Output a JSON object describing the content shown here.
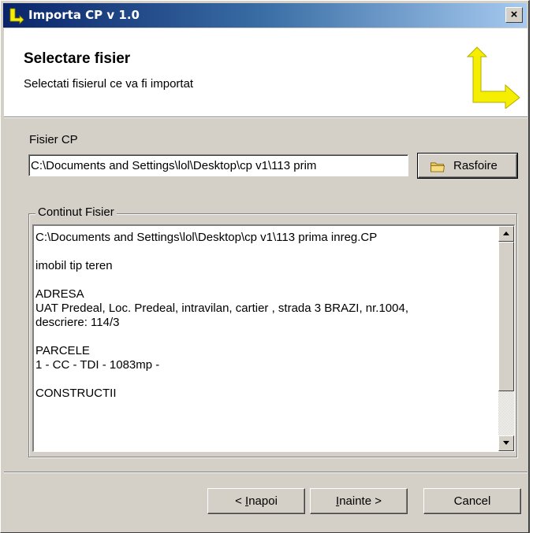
{
  "window": {
    "title": "Importa CP v 1.0",
    "close_glyph": "×"
  },
  "header": {
    "title": "Selectare fisier",
    "subtitle": "Selectati fisierul ce va fi importat"
  },
  "file": {
    "label": "Fisier CP",
    "path_value": "C:\\Documents and Settings\\lol\\Desktop\\cp v1\\113 prim",
    "browse_label": "Rasfoire"
  },
  "content_group": {
    "legend": "Continut Fisier",
    "text": "C:\\Documents and Settings\\lol\\Desktop\\cp v1\\113 prima inreg.CP\n\nimobil tip teren\n\nADRESA\nUAT Predeal, Loc. Predeal, intravilan, cartier , strada 3 BRAZI, nr.1004,\ndescriere: 114/3\n\nPARCELE\n1 - CC - TDI - 1083mp -\n\nCONSTRUCTII"
  },
  "footer": {
    "back_prefix": "< ",
    "back_accel": "I",
    "back_rest": "napoi",
    "next_accel": "I",
    "next_rest": "nainte >",
    "cancel_label": "Cancel"
  },
  "colors": {
    "accent_icon": "#f5ee00",
    "title_bar": "#0a246a",
    "dialog_face": "#d4d0c8"
  },
  "icons": {
    "title_icon": "import-arrow-icon",
    "logo_icon": "import-arrow-icon",
    "browse_icon": "folder-icon"
  }
}
